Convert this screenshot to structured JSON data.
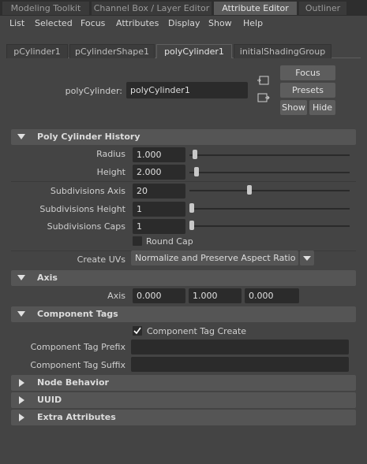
{
  "top_tabs": [
    {
      "label": "Modeling Toolkit"
    },
    {
      "label": "Channel Box / Layer Editor"
    },
    {
      "label": "Attribute Editor"
    },
    {
      "label": "Outliner"
    }
  ],
  "menu": [
    "List",
    "Selected",
    "Focus",
    "Attributes",
    "Display",
    "Show",
    "Help"
  ],
  "node_tabs": [
    {
      "label": "pCylinder1"
    },
    {
      "label": "pCylinderShape1"
    },
    {
      "label": "polyCylinder1"
    },
    {
      "label": "initialShadingGroup"
    }
  ],
  "node": {
    "label": "polyCylinder:",
    "value": "polyCylinder1"
  },
  "buttons": {
    "focus": "Focus",
    "presets": "Presets",
    "show": "Show",
    "hide": "Hide"
  },
  "sections": {
    "history": {
      "title": "Poly Cylinder History",
      "radius": {
        "label": "Radius",
        "value": "1.000",
        "level": 0.02
      },
      "height": {
        "label": "Height",
        "value": "2.000",
        "level": 0.03
      },
      "subdiv_axis": {
        "label": "Subdivisions Axis",
        "value": "20",
        "level": 0.37
      },
      "subdiv_height": {
        "label": "Subdivisions Height",
        "value": "1",
        "level": 0.0
      },
      "subdiv_caps": {
        "label": "Subdivisions Caps",
        "value": "1",
        "level": 0.0
      },
      "round_cap": {
        "label": "Round Cap",
        "checked": false
      },
      "create_uvs": {
        "label": "Create UVs",
        "value": "Normalize and Preserve Aspect Ratio"
      }
    },
    "axis": {
      "title": "Axis",
      "label": "Axis",
      "values": [
        "0.000",
        "1.000",
        "0.000"
      ]
    },
    "component_tags": {
      "title": "Component Tags",
      "create": {
        "label": "Component Tag Create",
        "checked": true
      },
      "prefix": {
        "label": "Component Tag Prefix",
        "value": ""
      },
      "suffix": {
        "label": "Component Tag Suffix",
        "value": ""
      }
    },
    "node_behavior": {
      "title": "Node Behavior"
    },
    "uuid": {
      "title": "UUID"
    },
    "extra": {
      "title": "Extra Attributes"
    }
  },
  "icons": {
    "select_node": "select-node-icon",
    "load_node": "load-node-icon",
    "check": "check-icon"
  }
}
